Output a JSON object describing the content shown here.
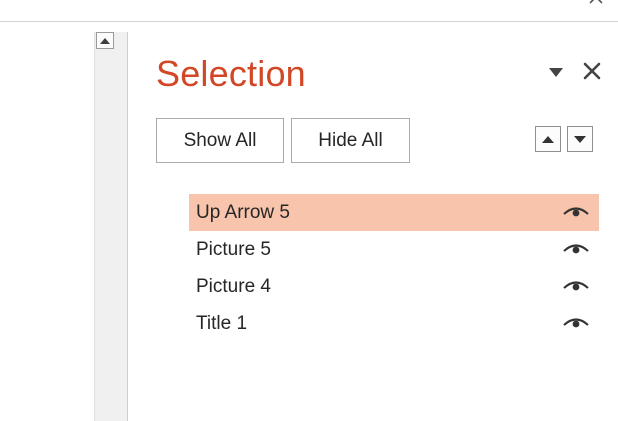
{
  "pane": {
    "title": "Selection",
    "show_all_label": "Show All",
    "hide_all_label": "Hide All",
    "options_icon": "triangle-down-icon",
    "close_icon": "close-icon",
    "bring_forward_icon": "triangle-up-icon",
    "send_backward_icon": "triangle-down-icon"
  },
  "items": [
    {
      "label": "Up Arrow 5",
      "selected": true,
      "visible": true
    },
    {
      "label": "Picture 5",
      "selected": false,
      "visible": true
    },
    {
      "label": "Picture 4",
      "selected": false,
      "visible": true
    },
    {
      "label": "Title 1",
      "selected": false,
      "visible": true
    }
  ],
  "colors": {
    "title": "#d24726",
    "selected_row": "#f8c5ac",
    "text": "#262626"
  }
}
